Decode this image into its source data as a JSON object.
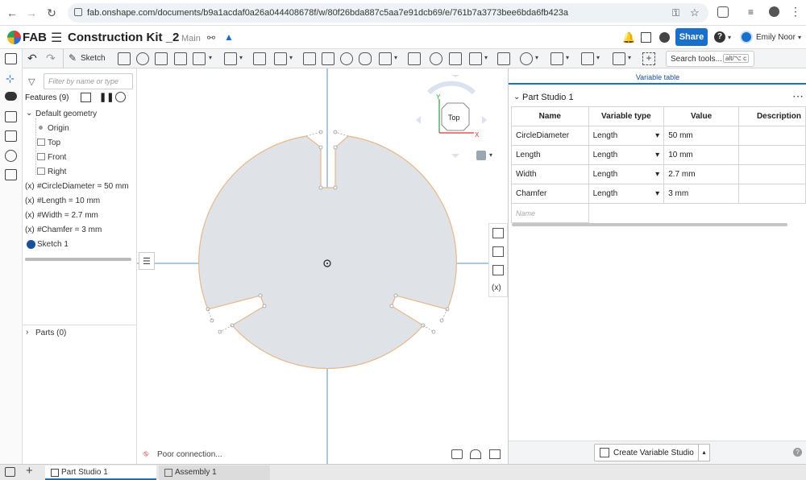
{
  "browser": {
    "url": "fab.onshape.com/documents/b9a1acdaf0a26a044408678f/w/80f26bda887c5aa7e91dcb69/e/761b7a3773bee6bda6fb423a"
  },
  "app": {
    "logo_text": "FAB",
    "doc_title": "Construction Kit _2",
    "branch": "Main",
    "share_label": "Share",
    "help_label": "?",
    "user_name": "Emily Noor"
  },
  "toolbar": {
    "sketch_label": "Sketch",
    "search_placeholder": "Search tools...",
    "search_shortcut": "alt/⌥ c"
  },
  "feature_panel": {
    "filter_placeholder": "Filter by name or type",
    "features_label": "Features (9)",
    "default_geometry": "Default geometry",
    "items": [
      "Origin",
      "Top",
      "Front",
      "Right"
    ],
    "variables": [
      "#CircleDiameter = 50 mm",
      "#Length = 10 mm",
      "#Width = 2.7 mm",
      "#Chamfer = 3 mm"
    ],
    "variable_prefix": "(x)",
    "sketch": "Sketch 1",
    "parts_label": "Parts (0)"
  },
  "viewport": {
    "view_cube_label": "Top",
    "axis_x": "X",
    "axis_y": "Y",
    "status": "Poor connection..."
  },
  "variable_table": {
    "tab_title": "Variable table",
    "studio_name": "Part Studio 1",
    "headers": [
      "Name",
      "Variable type",
      "Value",
      "Description"
    ],
    "rows": [
      {
        "name": "CircleDiameter",
        "type": "Length",
        "value": "50 mm"
      },
      {
        "name": "Length",
        "type": "Length",
        "value": "10 mm"
      },
      {
        "name": "Width",
        "type": "Length",
        "value": "2.7 mm"
      },
      {
        "name": "Chamfer",
        "type": "Length",
        "value": "3 mm"
      }
    ],
    "name_placeholder": "Name",
    "create_button": "Create Variable Studio"
  },
  "tabs": [
    "Part Studio 1",
    "Assembly 1"
  ],
  "colors": {
    "accent": "#1a6fc9",
    "sketch_fill": "#dfe3e7",
    "sketch_edge": "#e8b88a",
    "axis": "#5b8fd1"
  }
}
